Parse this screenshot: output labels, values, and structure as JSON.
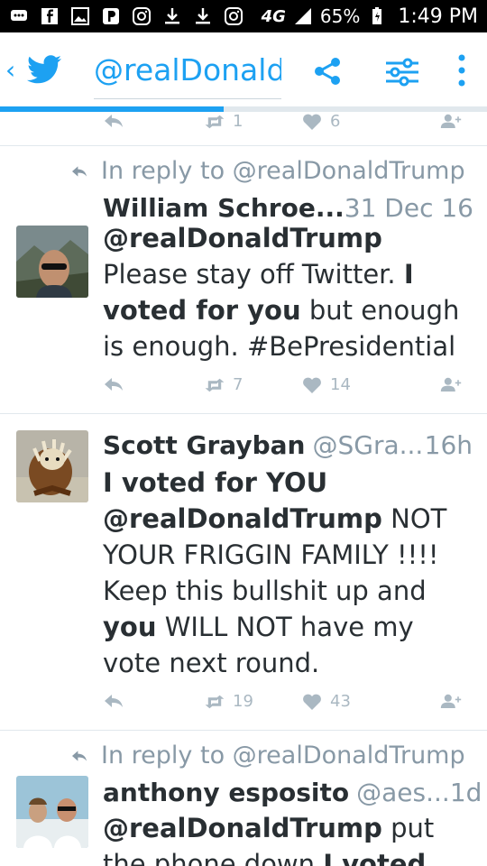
{
  "status_bar": {
    "network": "4G",
    "battery": "65%",
    "time": "1:49 PM"
  },
  "app_bar": {
    "title": "@realDonald",
    "icons": [
      "back-chevron",
      "twitter-bird",
      "share",
      "filter-sliders",
      "more-vertical"
    ],
    "accent_color": "#1da1f2",
    "load_progress": 0.46
  },
  "top_actions": {
    "retweets": "1",
    "likes": "6"
  },
  "tweets": [
    {
      "reply_context": "In reply to @realDonaldTrump",
      "name": "William Schroe...",
      "handle": "",
      "time": "31 Dec 16",
      "body_mention": "@realDonaldTrump",
      "body_plain_1": " Please stay off Twitter.  ",
      "body_bold_1": "I voted for you",
      "body_plain_2": " but enough is enough.  #BePresidential",
      "retweets": "7",
      "likes": "14"
    },
    {
      "reply_context": "",
      "name": "Scott Grayban",
      "handle": "@SGra...",
      "time": "16h",
      "body_bold_0": "I voted for YOU",
      "body_mention": "@realDonaldTrump",
      "body_plain_1": " NOT YOUR FRIGGIN FAMILY !!!! Keep this bullshit up and ",
      "body_bold_1": "you",
      "body_plain_2": " WILL NOT have my vote next round.",
      "retweets": "19",
      "likes": "43"
    },
    {
      "reply_context": "In reply to @realDonaldTrump",
      "name": "anthony esposito",
      "handle": "@aes...",
      "time": "1d",
      "body_mention": "@realDonaldTrump",
      "body_plain_1": " put the phone down ",
      "body_bold_1": "I voted"
    }
  ]
}
